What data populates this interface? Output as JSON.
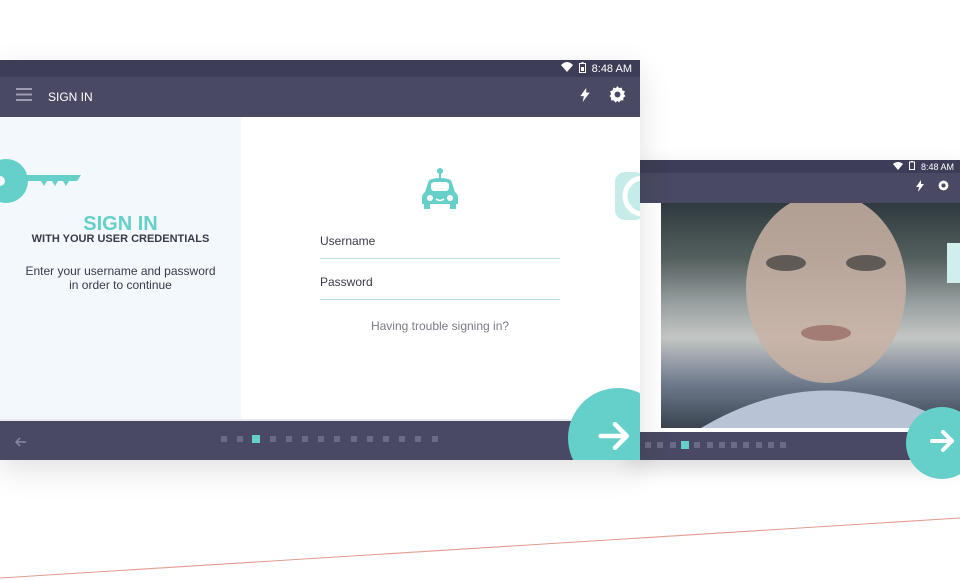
{
  "colors": {
    "accent": "#65d0c9",
    "bar": "#4a4963",
    "status": "#3e3d57",
    "panel": "#f3f8fc"
  },
  "main_device": {
    "status_time": "8:48 AM",
    "app_title": "SIGN IN",
    "left_panel": {
      "heading": "SIGN IN",
      "subheading": "WITH YOUR USER CREDENTIALS",
      "description_line1": "Enter your username and password",
      "description_line2": "in order to continue"
    },
    "form": {
      "username_placeholder": "Username",
      "password_placeholder": "Password",
      "trouble_link": "Having trouble signing in?"
    },
    "pager": {
      "total": 14,
      "active": 2
    }
  },
  "second_device": {
    "status_time": "8:48 AM",
    "pager": {
      "total": 12,
      "active": 3
    }
  },
  "icons": [
    "menu-icon",
    "flash-icon",
    "settings-icon",
    "key-icon",
    "robot-car-icon",
    "back-arrow-icon",
    "next-arrow-icon",
    "wifi-icon",
    "battery-icon"
  ]
}
